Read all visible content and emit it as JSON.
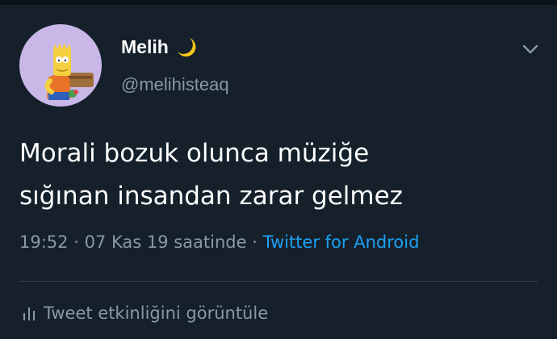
{
  "tweet": {
    "author": {
      "display_name": "Melih",
      "name_emoji_icon": "crescent-moon-icon",
      "handle": "@melihisteaq",
      "avatar_icon": "cartoon-avatar"
    },
    "menu_icon": "chevron-down-icon",
    "text_lines": [
      "Morali bozuk olunca müziğe",
      "sığınan insandan zarar gelmez"
    ],
    "meta": {
      "time": "19:52",
      "separator_1": " · ",
      "date": "07 Kas 19 saatinde",
      "separator_2": " · ",
      "source": "Twitter for Android"
    },
    "activity": {
      "icon": "bar-chart-icon",
      "label": "Tweet etkinliğini görüntüle"
    }
  },
  "colors": {
    "background": "#15202b",
    "primary_text": "#ffffff",
    "secondary_text": "#8899a6",
    "link": "#1da1f2",
    "divider": "#38444d",
    "avatar_bg": "#c9b7e8"
  }
}
